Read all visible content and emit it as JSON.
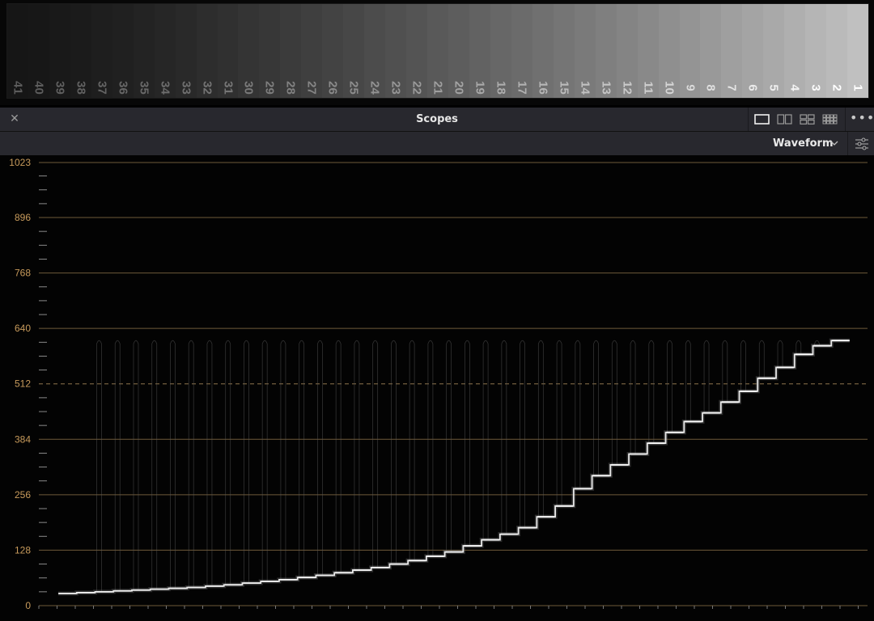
{
  "chart_strip": {
    "patch_labels": [
      "41",
      "40",
      "39",
      "38",
      "37",
      "36",
      "35",
      "34",
      "33",
      "32",
      "31",
      "30",
      "29",
      "28",
      "27",
      "26",
      "25",
      "24",
      "23",
      "22",
      "21",
      "20",
      "19",
      "18",
      "17",
      "16",
      "15",
      "14",
      "13",
      "12",
      "11",
      "10",
      "9",
      "8",
      "7",
      "6",
      "5",
      "4",
      "3",
      "2",
      "1"
    ]
  },
  "header": {
    "title": "Scopes",
    "close_icon": "close-icon",
    "layout_options": [
      "single-layout-icon",
      "dual-layout-icon",
      "quad-layout-icon",
      "multi-layout-icon"
    ],
    "more_icon": "more-options-icon"
  },
  "toolbar": {
    "scope_type": "Waveform",
    "settings_icon": "sliders-icon"
  },
  "chart_data": {
    "type": "waveform",
    "y_ticks": [
      "1023",
      "896",
      "768",
      "640",
      "512",
      "384",
      "256",
      "128",
      "0"
    ],
    "ylim": [
      0,
      1023
    ],
    "reference_line": 512,
    "steps": [
      28,
      30,
      32,
      34,
      36,
      38,
      40,
      42,
      45,
      48,
      52,
      56,
      60,
      65,
      70,
      76,
      82,
      88,
      96,
      104,
      114,
      124,
      138,
      152,
      165,
      180,
      205,
      230,
      270,
      300,
      325,
      350,
      375,
      400,
      425,
      445,
      470,
      495,
      525,
      550,
      580,
      600,
      612
    ],
    "peak_level": 612
  }
}
